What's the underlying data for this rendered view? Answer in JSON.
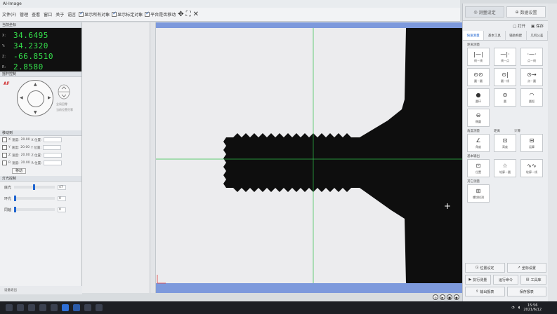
{
  "window": {
    "title": "AI-Image"
  },
  "menu": {
    "items": [
      "文件(F)",
      "管理",
      "查看",
      "窗口",
      "关于",
      "语言"
    ],
    "checkboxes": [
      {
        "label": "显示所有对象",
        "checked": true
      },
      {
        "label": "显示标定对象",
        "checked": true
      },
      {
        "label": "平台是否移动",
        "checked": true
      }
    ]
  },
  "left_panel": {
    "coords_header": "当前坐标",
    "readout": [
      {
        "axis": "X:",
        "value": "34.6495"
      },
      {
        "axis": "Y:",
        "value": "34.2320"
      },
      {
        "axis": "Z:",
        "value": "-66.8510"
      },
      {
        "axis": "R:",
        "value": "2.8580"
      }
    ],
    "joystick_header": "摇杆控制",
    "auto_label": "AF",
    "zoom_labels": [
      "全局回零",
      "当前位置归零"
    ],
    "move_header": "移动到",
    "move_rows": [
      {
        "axis": "X",
        "speed_label": "速度:",
        "speed": "20.00",
        "pos_label": "X 位置:"
      },
      {
        "axis": "Y",
        "speed_label": "速度:",
        "speed": "20.00",
        "pos_label": "Y 位置:"
      },
      {
        "axis": "Z",
        "speed_label": "速度:",
        "speed": "20.00",
        "pos_label": "Z 位置:"
      },
      {
        "axis": "R",
        "speed_label": "速度:",
        "speed": "20.00",
        "pos_label": "R 位置:"
      }
    ],
    "move_button": "移动",
    "light_header": "灯光控制",
    "lights": [
      {
        "label": "底光",
        "value": "47",
        "level": 0.47
      },
      {
        "label": "环光",
        "value": "0",
        "level": 0
      },
      {
        "label": "同轴",
        "value": "0",
        "level": 0
      }
    ],
    "bottom_label": "设备退出"
  },
  "right_panel": {
    "header_buttons": [
      "测量设定",
      "数据设置"
    ],
    "file_buttons": [
      "打开",
      "保存"
    ],
    "tabs": [
      "快速测量",
      "基本工具",
      "辅助构建",
      "几何公差"
    ],
    "groups": [
      {
        "title": "距离测量",
        "tools": [
          {
            "icon": "line-line-icon",
            "glyph": "|—|",
            "label": "线－线"
          },
          {
            "icon": "line-point-icon",
            "glyph": "—|·",
            "label": "线－点"
          },
          {
            "icon": "point-line-icon",
            "glyph": "·—·",
            "label": "点－线"
          },
          {
            "icon": "circle-circle-icon",
            "glyph": "⊙⊙",
            "label": "圆－圆"
          },
          {
            "icon": "circle-line-icon",
            "glyph": "⊙|",
            "label": "圆－线"
          },
          {
            "icon": "circle-point-icon",
            "glyph": "⊙→",
            "label": "点－圆"
          },
          {
            "icon": "circle-ring-icon",
            "glyph": "●",
            "label": "圆环"
          },
          {
            "icon": "circle-icon",
            "glyph": "⊖",
            "label": "圆"
          },
          {
            "icon": "arc-icon",
            "glyph": "◠",
            "label": "圆弧"
          },
          {
            "icon": "ellipse-icon",
            "glyph": "⊖",
            "label": "椭圆"
          }
        ]
      },
      {
        "title": "角度测量",
        "extra_titles": [
          "距离",
          "计算"
        ],
        "tools": [
          {
            "icon": "angle-icon",
            "glyph": "∠",
            "label": "角度"
          },
          {
            "icon": "height-icon",
            "glyph": "⊡",
            "label": "高度"
          },
          {
            "icon": "calculate-icon",
            "glyph": "⊟",
            "label": "运算"
          }
        ]
      },
      {
        "title": "基本输出",
        "tools": [
          {
            "icon": "position-icon",
            "glyph": "⊡",
            "label": "位置"
          },
          {
            "icon": "contour-icon",
            "glyph": "☆",
            "label": "轮廓－圆"
          },
          {
            "icon": "wave-icon",
            "glyph": "∿∿",
            "label": "轮廓－线"
          }
        ]
      },
      {
        "title": "其它测量",
        "tools": [
          {
            "icon": "thread-icon",
            "glyph": "⊞",
            "label": "螺纹检测"
          }
        ]
      }
    ],
    "bottom_rows": [
      [
        "位置设定",
        "坐标设置"
      ],
      [
        "执行测量",
        "运行命令",
        "工具库"
      ],
      [
        "输出报表",
        "保存报表"
      ]
    ]
  },
  "camera": {
    "statusbar": [
      "⊖",
      "▶",
      "■",
      "●"
    ]
  },
  "taskbar": {
    "time": "15:56",
    "date": "2021/6/12"
  }
}
